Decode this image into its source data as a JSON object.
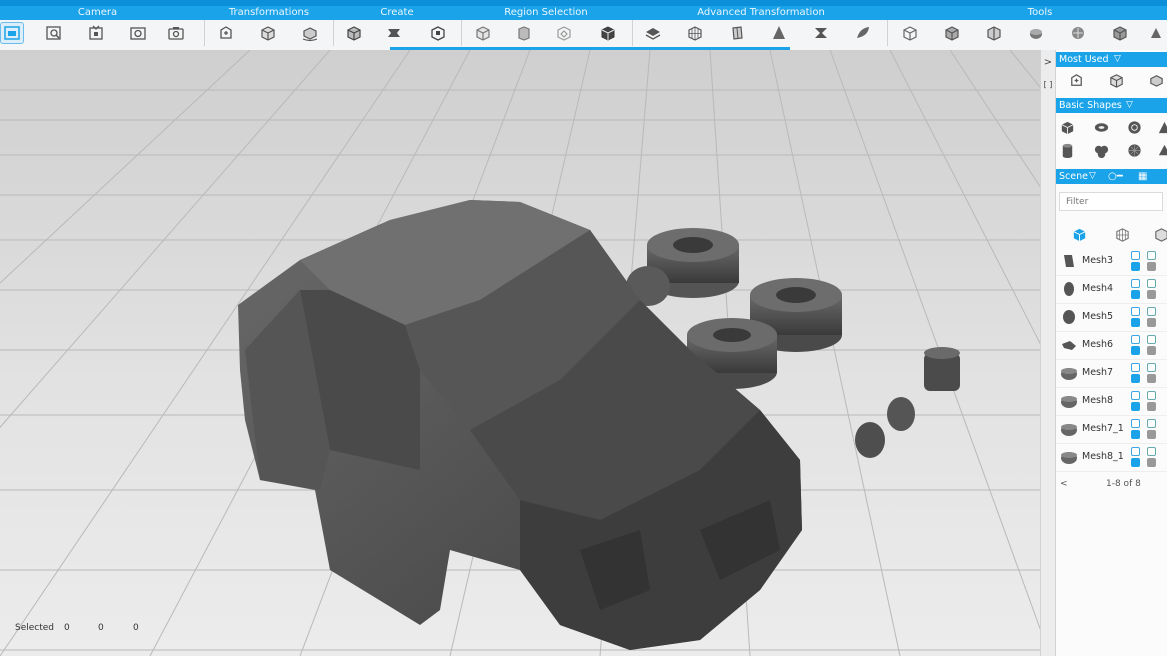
{
  "ribbon": {
    "groups": [
      {
        "label": "Camera"
      },
      {
        "label": "Transformations"
      },
      {
        "label": "Create"
      },
      {
        "label": "Region Selection"
      },
      {
        "label": "Advanced Transformation"
      },
      {
        "label": "Tools"
      }
    ],
    "tools": [
      {
        "name": "home-view-icon"
      },
      {
        "name": "zoom-to-selection-icon"
      },
      {
        "name": "camera-front-icon"
      },
      {
        "name": "camera-rotate-icon"
      },
      {
        "name": "camera-snapshot-icon"
      },
      {
        "name": "move-icon"
      },
      {
        "name": "scale-icon"
      },
      {
        "name": "rotate-icon"
      },
      {
        "name": "box-create-icon"
      },
      {
        "name": "extrude-icon"
      },
      {
        "name": "mirror-icon"
      },
      {
        "name": "select-region-icon"
      },
      {
        "name": "select-face-icon"
      },
      {
        "name": "select-lasso-icon"
      },
      {
        "name": "select-invert-icon"
      },
      {
        "name": "smooth-icon"
      },
      {
        "name": "subdivide-icon"
      },
      {
        "name": "bend-icon"
      },
      {
        "name": "cone-icon"
      },
      {
        "name": "twist-icon"
      },
      {
        "name": "sculpt-icon"
      },
      {
        "name": "measure-icon"
      },
      {
        "name": "hollow-icon"
      },
      {
        "name": "split-icon"
      },
      {
        "name": "repair-icon"
      },
      {
        "name": "shell-icon"
      },
      {
        "name": "analyze-icon"
      },
      {
        "name": "more-tools-icon"
      }
    ],
    "accent": "#1aa3e8"
  },
  "side_strip": {
    "collapse": ">",
    "pin": "[ ]"
  },
  "panel": {
    "most_used": {
      "title": "Most Used"
    },
    "basic_shapes": {
      "title": "Basic Shapes"
    },
    "scene": {
      "title": "Scene"
    },
    "filter_placeholder": "Filter",
    "meshes": [
      {
        "name": "Mesh3"
      },
      {
        "name": "Mesh4"
      },
      {
        "name": "Mesh5"
      },
      {
        "name": "Mesh6"
      },
      {
        "name": "Mesh7"
      },
      {
        "name": "Mesh8"
      },
      {
        "name": "Mesh7_1"
      },
      {
        "name": "Mesh8_1"
      }
    ],
    "pager": {
      "prev": "<",
      "label": "1-8 of 8"
    }
  },
  "status": {
    "label": "Selected",
    "v1": "0",
    "v2": "0",
    "v3": "0"
  }
}
